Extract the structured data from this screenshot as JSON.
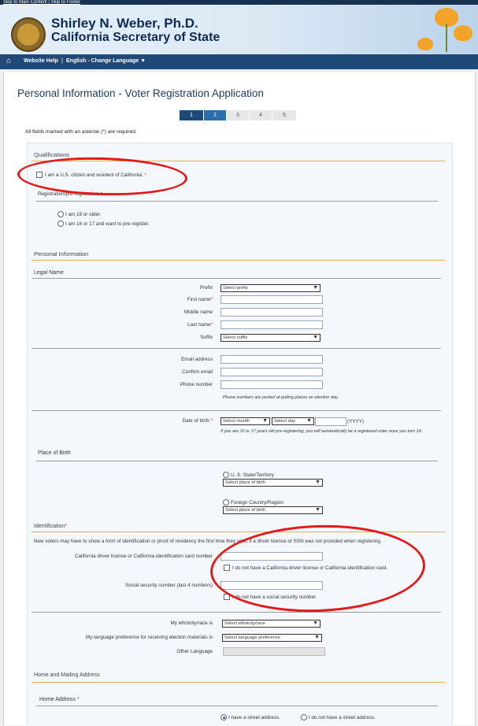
{
  "skip_links": "Skip to Main Content | Skip to Footer",
  "header": {
    "name": "Shirley N. Weber, Ph.D.",
    "office": "California Secretary of State"
  },
  "nav": {
    "home_icon": "home-icon",
    "help": "Website Help",
    "separator": "|",
    "language": "English - Change Language ▼"
  },
  "page": {
    "title": "Personal Information - Voter Registration Application",
    "steps": [
      "1",
      "2",
      "3",
      "4",
      "5"
    ],
    "current_step": 2,
    "required_note": "All fields marked with an asterisk (*) are required."
  },
  "qualifications": {
    "heading": "Qualifications",
    "citizen": "I am a U.S. citizen and resident of California.",
    "citizen_star": "*",
    "reg_heading": "Registration/pre-registration",
    "reg_star": "*",
    "opt1": "I am 18 or older.",
    "opt2": "I am 16 or 17 and want to pre-register."
  },
  "personal": {
    "heading": "Personal Information",
    "legal_name": "Legal Name",
    "prefix_label": "Prefix",
    "prefix_value": "Select prefix",
    "first_label": "First name",
    "middle_label": "Middle name",
    "last_label": "Last name",
    "suffix_label": "Suffix",
    "suffix_value": "Select suffix",
    "email_label": "Email address",
    "confirm_label": "Confirm email",
    "phone_label": "Phone number",
    "phone_note": "Phone numbers are posted at polling places on election day.",
    "dob_label": "Date of birth",
    "month_value": "Select month",
    "day_value": "Select day",
    "yyyy": "(YYYY)",
    "dob_note": "If you are 16 or 17 years old pre-registering, you will automatically be a registered voter once you turn 18."
  },
  "birth": {
    "heading": "Place of Birth",
    "us": "U. S. State/Territory",
    "us_select": "Select place of birth",
    "foreign": "Foreign Country/Region",
    "foreign_select": "Select place of birth"
  },
  "identification": {
    "heading": "Identification",
    "note": "New voters may have to show a form of identification or proof of residency the first time they vote, if a driver license or SSN was not provided when registering.",
    "dl_label": "California driver license or California identification card number",
    "dl_none": "I do not have a California driver license or California identification card.",
    "ssn_label": "Social security number (last 4 numbers)",
    "ssn_none": "I do not have a social security number.",
    "ethnicity_label": "My ethnicity/race is",
    "ethnicity_value": "Select ethnicity/race",
    "language_label": "My language preference for receiving election materials is",
    "language_value": "Select language preference",
    "other_label": "Other Language"
  },
  "address": {
    "heading": "Home and Mailing Address",
    "home": "Home Address",
    "street": "I have a street address.",
    "no_street": "I do not have a street address."
  }
}
